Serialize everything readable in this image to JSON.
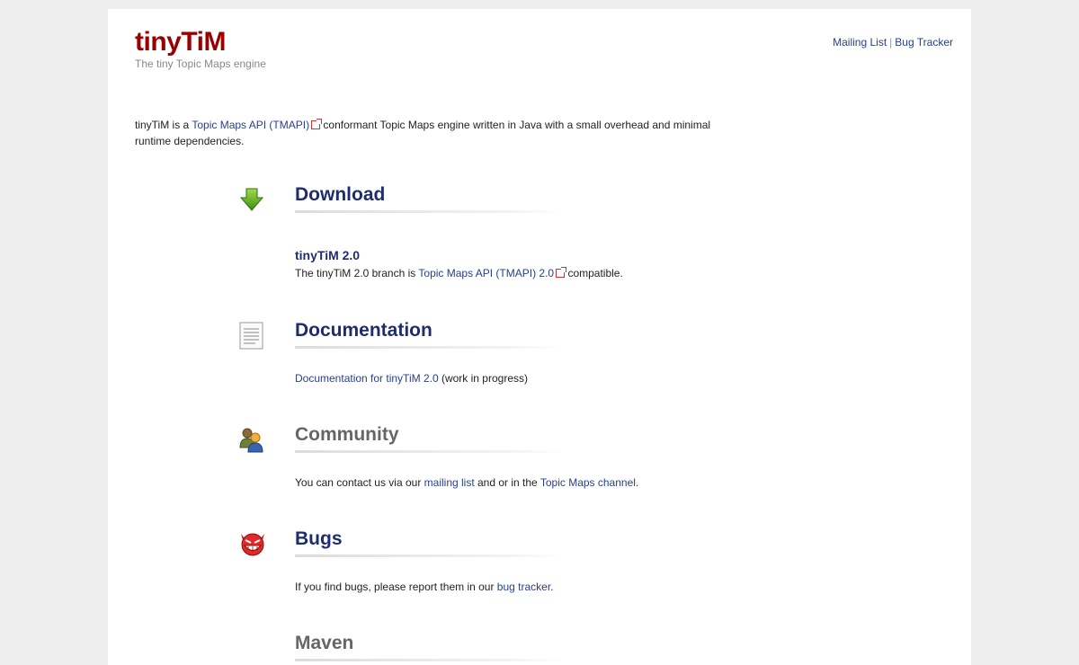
{
  "header": {
    "logo": "tinyTiM",
    "tagline": "The tiny Topic Maps engine",
    "links": {
      "mailing": "Mailing List",
      "separator": "|",
      "bugtracker": "Bug Tracker"
    }
  },
  "intro": {
    "prefix": "tinyTiM is a ",
    "tmapi_link": "Topic Maps API (TMAPI)",
    "suffix": " conformant Topic Maps engine written in Java with a small overhead and minimal runtime dependencies."
  },
  "sections": {
    "download": {
      "icon": "download-arrow-icon",
      "title": "Download",
      "subtitle": "tinyTiM 2.0",
      "text_prefix": "The tinyTiM 2.0 branch is ",
      "link": "Topic Maps API (TMAPI) 2.0",
      "text_suffix": " compatible."
    },
    "documentation": {
      "icon": "document-icon",
      "title": "Documentation",
      "link": "Documentation for tinyTiM 2.0",
      "text_suffix": " (work in progress)"
    },
    "community": {
      "icon": "people-icon",
      "title": "Community",
      "text_prefix": "You can contact us via our ",
      "link1": "mailing list",
      "text_mid": " and or in the ",
      "link2": "Topic Maps channel",
      "text_suffix": "."
    },
    "bugs": {
      "icon": "devil-icon",
      "title": "Bugs",
      "text_prefix": "If you find bugs, please report them in our ",
      "link": "bug tracker",
      "text_suffix": "."
    },
    "maven": {
      "title": "Maven"
    }
  },
  "colors": {
    "logo": "#990000",
    "link": "#2a3f8a",
    "heading": "#1f2d6e"
  }
}
